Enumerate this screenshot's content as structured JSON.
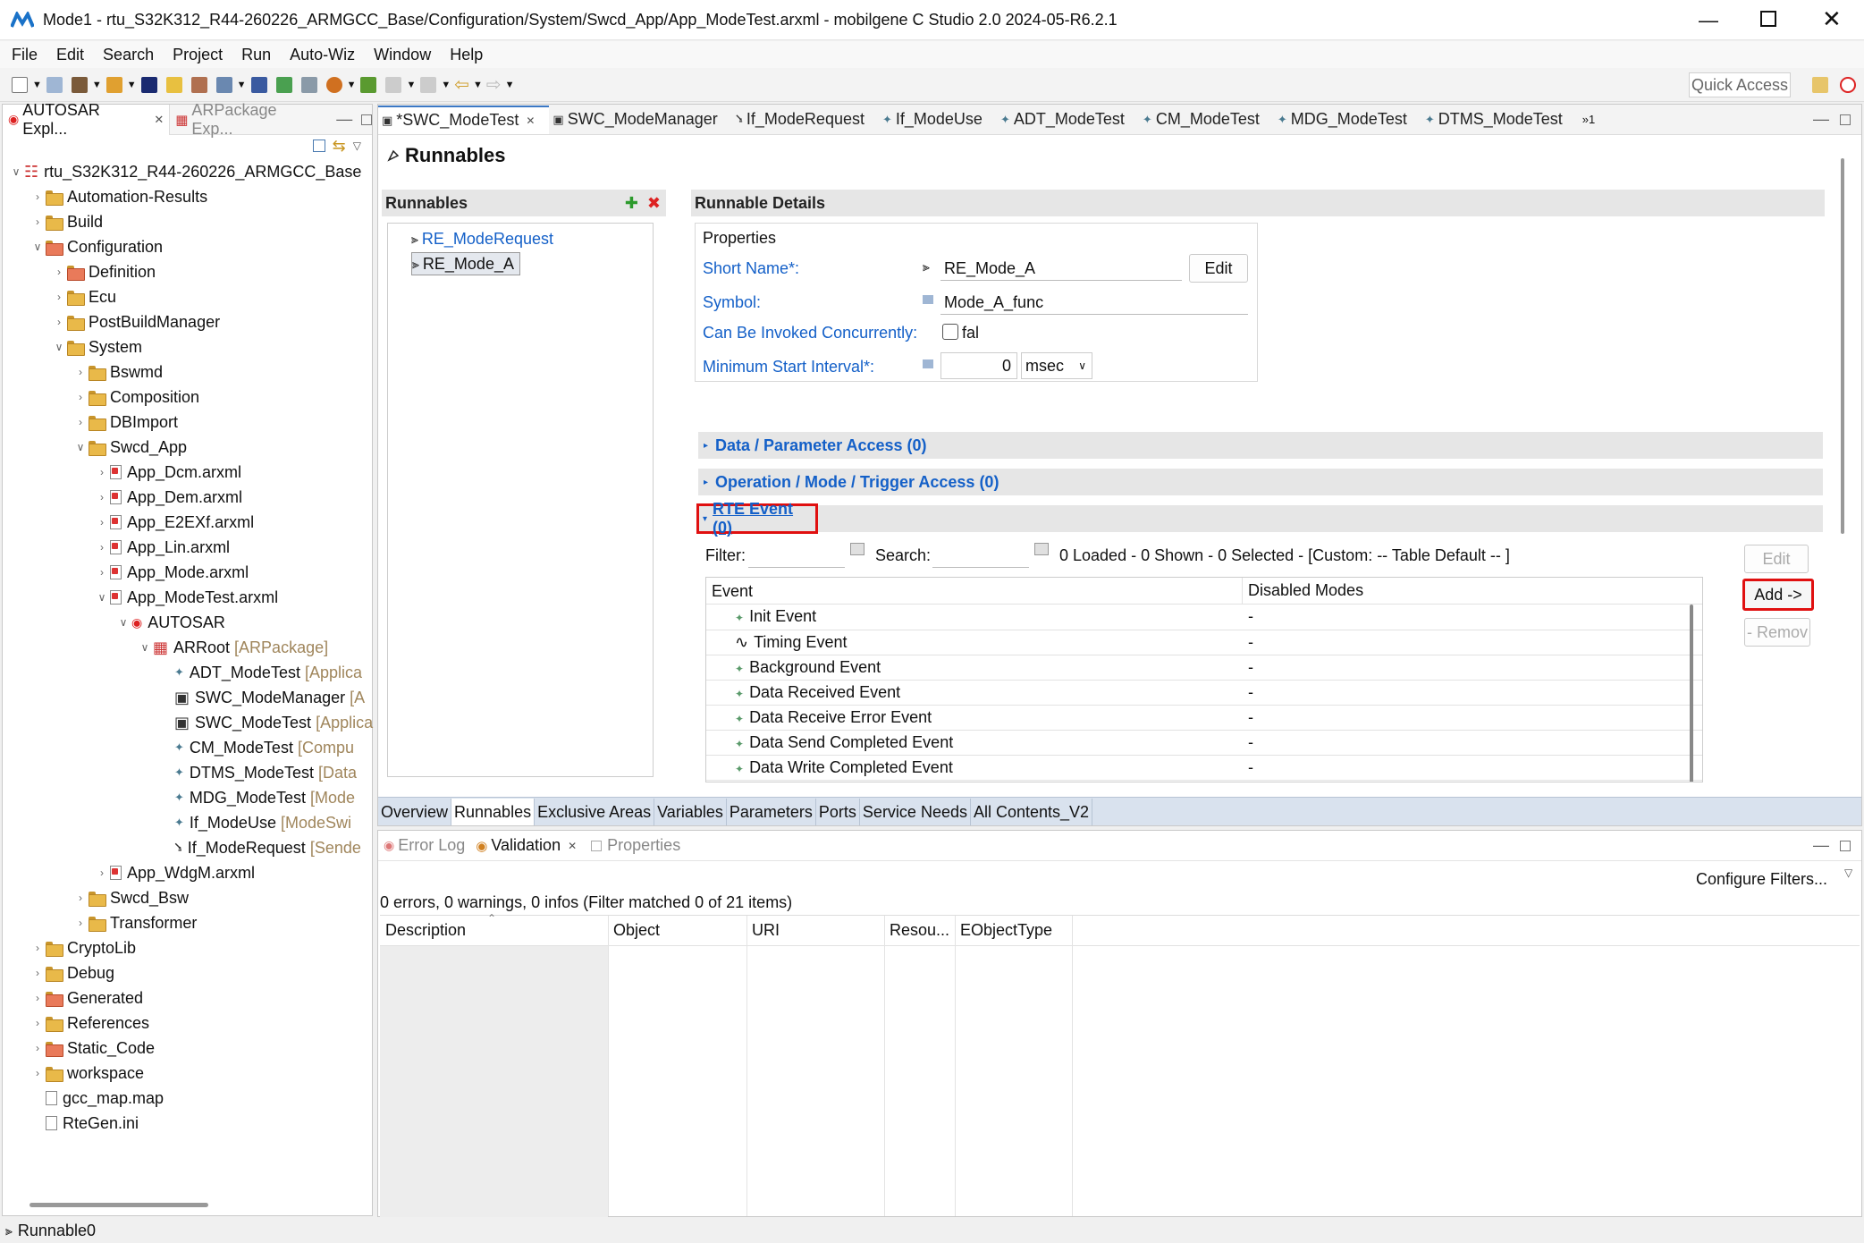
{
  "window": {
    "title": "Mode1 - rtu_S32K312_R44-260226_ARMGCC_Base/Configuration/System/Swcd_App/App_ModeTest.arxml - mobilgene C Studio 2.0 2024-05-R6.2.1"
  },
  "menu": [
    "File",
    "Edit",
    "Search",
    "Project",
    "Run",
    "Auto-Wiz",
    "Window",
    "Help"
  ],
  "toolbar": {
    "quick_access": "Quick Access"
  },
  "left_panel": {
    "tabs": [
      "AUTOSAR Expl...",
      "ARPackage Exp..."
    ],
    "tree": [
      {
        "d": 0,
        "t": "rtu_S32K312_R44-260226_ARMGCC_Base",
        "i": "proj",
        "c": "v"
      },
      {
        "d": 1,
        "t": "Automation-Results",
        "i": "folder",
        "c": ">"
      },
      {
        "d": 1,
        "t": "Build",
        "i": "folder",
        "c": ">"
      },
      {
        "d": 1,
        "t": "Configuration",
        "i": "rfolder",
        "c": "v"
      },
      {
        "d": 2,
        "t": "Definition",
        "i": "rfolder",
        "c": ">"
      },
      {
        "d": 2,
        "t": "Ecu",
        "i": "folder",
        "c": ">"
      },
      {
        "d": 2,
        "t": "PostBuildManager",
        "i": "folder",
        "c": ">"
      },
      {
        "d": 2,
        "t": "System",
        "i": "folder",
        "c": "v"
      },
      {
        "d": 3,
        "t": "Bswmd",
        "i": "folder",
        "c": ">"
      },
      {
        "d": 3,
        "t": "Composition",
        "i": "folder",
        "c": ">"
      },
      {
        "d": 3,
        "t": "DBImport",
        "i": "folder",
        "c": ">"
      },
      {
        "d": 3,
        "t": "Swcd_App",
        "i": "folder",
        "c": "v"
      },
      {
        "d": 4,
        "t": "App_Dcm.arxml",
        "i": "file",
        "c": ">"
      },
      {
        "d": 4,
        "t": "App_Dem.arxml",
        "i": "file",
        "c": ">"
      },
      {
        "d": 4,
        "t": "App_E2EXf.arxml",
        "i": "file",
        "c": ">"
      },
      {
        "d": 4,
        "t": "App_Lin.arxml",
        "i": "file",
        "c": ">"
      },
      {
        "d": 4,
        "t": "App_Mode.arxml",
        "i": "file",
        "c": ">"
      },
      {
        "d": 4,
        "t": "App_ModeTest.arxml",
        "i": "file",
        "c": "v"
      },
      {
        "d": 5,
        "t": "AUTOSAR",
        "i": "autosar",
        "c": "v"
      },
      {
        "d": 6,
        "t": "ARRoot",
        "x": "[ARPackage]",
        "i": "pkg",
        "c": "v"
      },
      {
        "d": 7,
        "t": "ADT_ModeTest",
        "x": "[Applica",
        "i": "star",
        "c": ""
      },
      {
        "d": 7,
        "t": "SWC_ModeManager",
        "x": "[A",
        "i": "swc",
        "c": ""
      },
      {
        "d": 7,
        "t": "SWC_ModeTest",
        "x": "[Applica",
        "i": "swc",
        "c": ""
      },
      {
        "d": 7,
        "t": "CM_ModeTest",
        "x": "[Compu",
        "i": "star",
        "c": ""
      },
      {
        "d": 7,
        "t": "DTMS_ModeTest",
        "x": "[Data",
        "i": "star",
        "c": ""
      },
      {
        "d": 7,
        "t": "MDG_ModeTest",
        "x": "[Mode",
        "i": "star",
        "c": ""
      },
      {
        "d": 7,
        "t": "If_ModeUse",
        "x": "[ModeSwi",
        "i": "star",
        "c": ""
      },
      {
        "d": 7,
        "t": "If_ModeRequest",
        "x": "[Sende",
        "i": "ifreq",
        "c": ""
      },
      {
        "d": 4,
        "t": "App_WdgM.arxml",
        "i": "file",
        "c": ">"
      },
      {
        "d": 3,
        "t": "Swcd_Bsw",
        "i": "folder",
        "c": ">"
      },
      {
        "d": 3,
        "t": "Transformer",
        "i": "folder",
        "c": ">"
      },
      {
        "d": 1,
        "t": "CryptoLib",
        "i": "folder",
        "c": ">"
      },
      {
        "d": 1,
        "t": "Debug",
        "i": "folder",
        "c": ">"
      },
      {
        "d": 1,
        "t": "Generated",
        "i": "rfolder",
        "c": ">"
      },
      {
        "d": 1,
        "t": "References",
        "i": "folder",
        "c": ">"
      },
      {
        "d": 1,
        "t": "Static_Code",
        "i": "rfolder",
        "c": ">"
      },
      {
        "d": 1,
        "t": "workspace",
        "i": "folder",
        "c": ">"
      },
      {
        "d": 1,
        "t": "gcc_map.map",
        "i": "plain",
        "c": ""
      },
      {
        "d": 1,
        "t": "RteGen.ini",
        "i": "plain",
        "c": ""
      }
    ]
  },
  "editor": {
    "tabs": [
      "*SWC_ModeTest",
      "SWC_ModeManager",
      "If_ModeRequest",
      "If_ModeUse",
      "ADT_ModeTest",
      "CM_ModeTest",
      "MDG_ModeTest",
      "DTMS_ModeTest"
    ],
    "overflow": "»1",
    "page_title": "Runnables",
    "runnables": {
      "header": "Runnables",
      "items": [
        "RE_ModeRequest",
        "RE_Mode_A"
      ]
    },
    "details": {
      "header": "Runnable Details",
      "properties_label": "Properties",
      "short_name_label": "Short Name*:",
      "short_name_value": "RE_Mode_A",
      "edit_label": "Edit",
      "symbol_label": "Symbol:",
      "symbol_value": "Mode_A_func",
      "concurrent_label": "Can Be Invoked Concurrently:",
      "concurrent_value": "fal",
      "min_interval_label": "Minimum Start Interval*:",
      "min_interval_value": "0",
      "min_interval_unit": "msec"
    },
    "sections": [
      "Data / Parameter Access (0)",
      "Operation / Mode / Trigger Access (0)",
      "RTE Event (0)"
    ],
    "rte": {
      "filter_label": "Filter:",
      "search_label": "Search:",
      "status": "0 Loaded - 0 Shown - 0 Selected -  [Custom: -- Table Default -- ]",
      "columns": [
        "Event",
        "Disabled Modes"
      ],
      "rows": [
        {
          "e": "Init Event",
          "m": "-",
          "i": "star"
        },
        {
          "e": "Timing Event",
          "m": "-",
          "i": "timing"
        },
        {
          "e": "Background Event",
          "m": "-",
          "i": "star"
        },
        {
          "e": "Data Received Event",
          "m": "-",
          "i": "star"
        },
        {
          "e": "Data Receive Error Event",
          "m": "-",
          "i": "star"
        },
        {
          "e": "Data Send Completed Event",
          "m": "-",
          "i": "star"
        },
        {
          "e": "Data Write Completed Event",
          "m": "-",
          "i": "star"
        }
      ],
      "edit_label": "Edit",
      "add_label": "Add ->",
      "remove_label": "- Remov"
    },
    "bottom_tabs": [
      "Overview",
      "Runnables",
      "Exclusive Areas",
      "Variables",
      "Parameters",
      "Ports",
      "Service Needs",
      "All Contents_V2"
    ]
  },
  "bottom_panel": {
    "tabs": [
      "Error Log",
      "Validation",
      "Properties"
    ],
    "configure": "Configure Filters...",
    "summary": "0 errors, 0 warnings, 0 infos (Filter matched 0 of 21 items)",
    "columns": [
      "Description",
      "Object",
      "URI",
      "Resou...",
      "EObjectType"
    ]
  },
  "status": {
    "text": "Runnable0"
  },
  "colors": {
    "accent": "#1460c8",
    "highlight": "#e01010",
    "selection": "#dde6f3"
  }
}
